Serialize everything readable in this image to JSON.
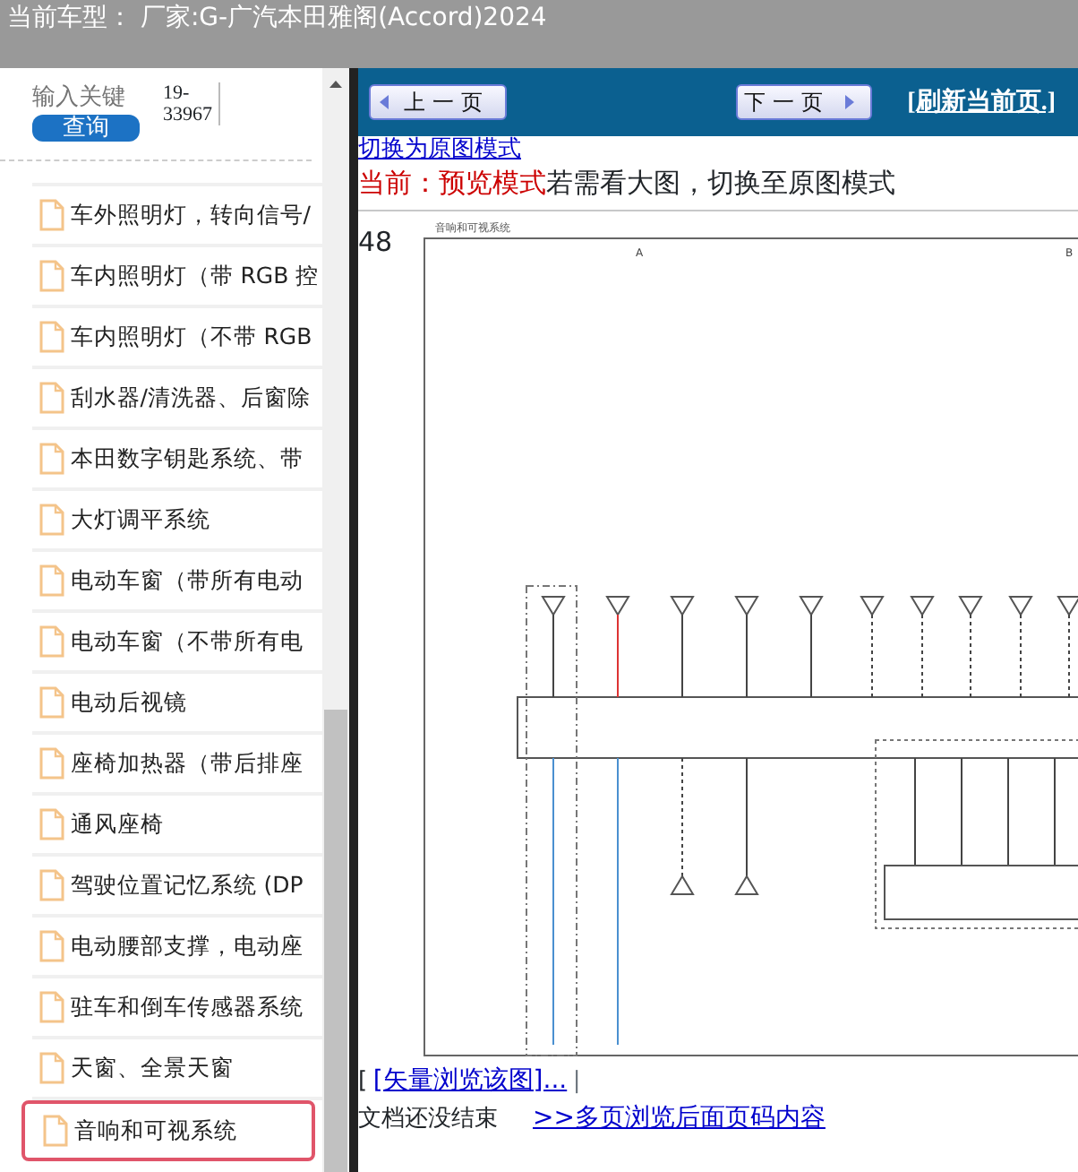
{
  "header": {
    "title": "当前车型： 厂家:G-广汽本田雅阁(Accord)2024"
  },
  "sidebar": {
    "search": {
      "placeholder": "输入关键",
      "button": "查询",
      "value": "19-33967"
    },
    "items": [
      {
        "label": "车外照明灯，转向信号/",
        "selected": false
      },
      {
        "label": "车内照明灯（带 RGB 控",
        "selected": false
      },
      {
        "label": "车内照明灯（不带 RGB",
        "selected": false
      },
      {
        "label": "刮水器/清洗器、后窗除",
        "selected": false
      },
      {
        "label": "本田数字钥匙系统、带",
        "selected": false
      },
      {
        "label": "大灯调平系统",
        "selected": false
      },
      {
        "label": "电动车窗（带所有电动",
        "selected": false
      },
      {
        "label": "电动车窗（不带所有电",
        "selected": false
      },
      {
        "label": "电动后视镜",
        "selected": false
      },
      {
        "label": "座椅加热器（带后排座",
        "selected": false
      },
      {
        "label": "通风座椅",
        "selected": false
      },
      {
        "label": "驾驶位置记忆系统 (DP",
        "selected": false
      },
      {
        "label": "电动腰部支撑，电动座",
        "selected": false
      },
      {
        "label": "驻车和倒车传感器系统",
        "selected": false
      },
      {
        "label": "天窗、全景天窗",
        "selected": false
      },
      {
        "label": "音响和可视系统",
        "selected": true
      }
    ]
  },
  "toolbar": {
    "prev": "上一页",
    "next": "下一页",
    "refresh": "[刷新当前页.]"
  },
  "content": {
    "switch_link": "切换为原图模式",
    "mode_label": "当前：预览模式",
    "mode_hint": "若需看大图，切换至原图模式",
    "page_number": "48",
    "diagram_title": "音响和可视系统",
    "columns": [
      "A",
      "B"
    ],
    "vector_bracket": "[",
    "vector_link": "[矢量浏览该图]...",
    "separator": "|",
    "end_text": "文档还没结束",
    "more_link": ">>多页浏览后面页码内容"
  }
}
